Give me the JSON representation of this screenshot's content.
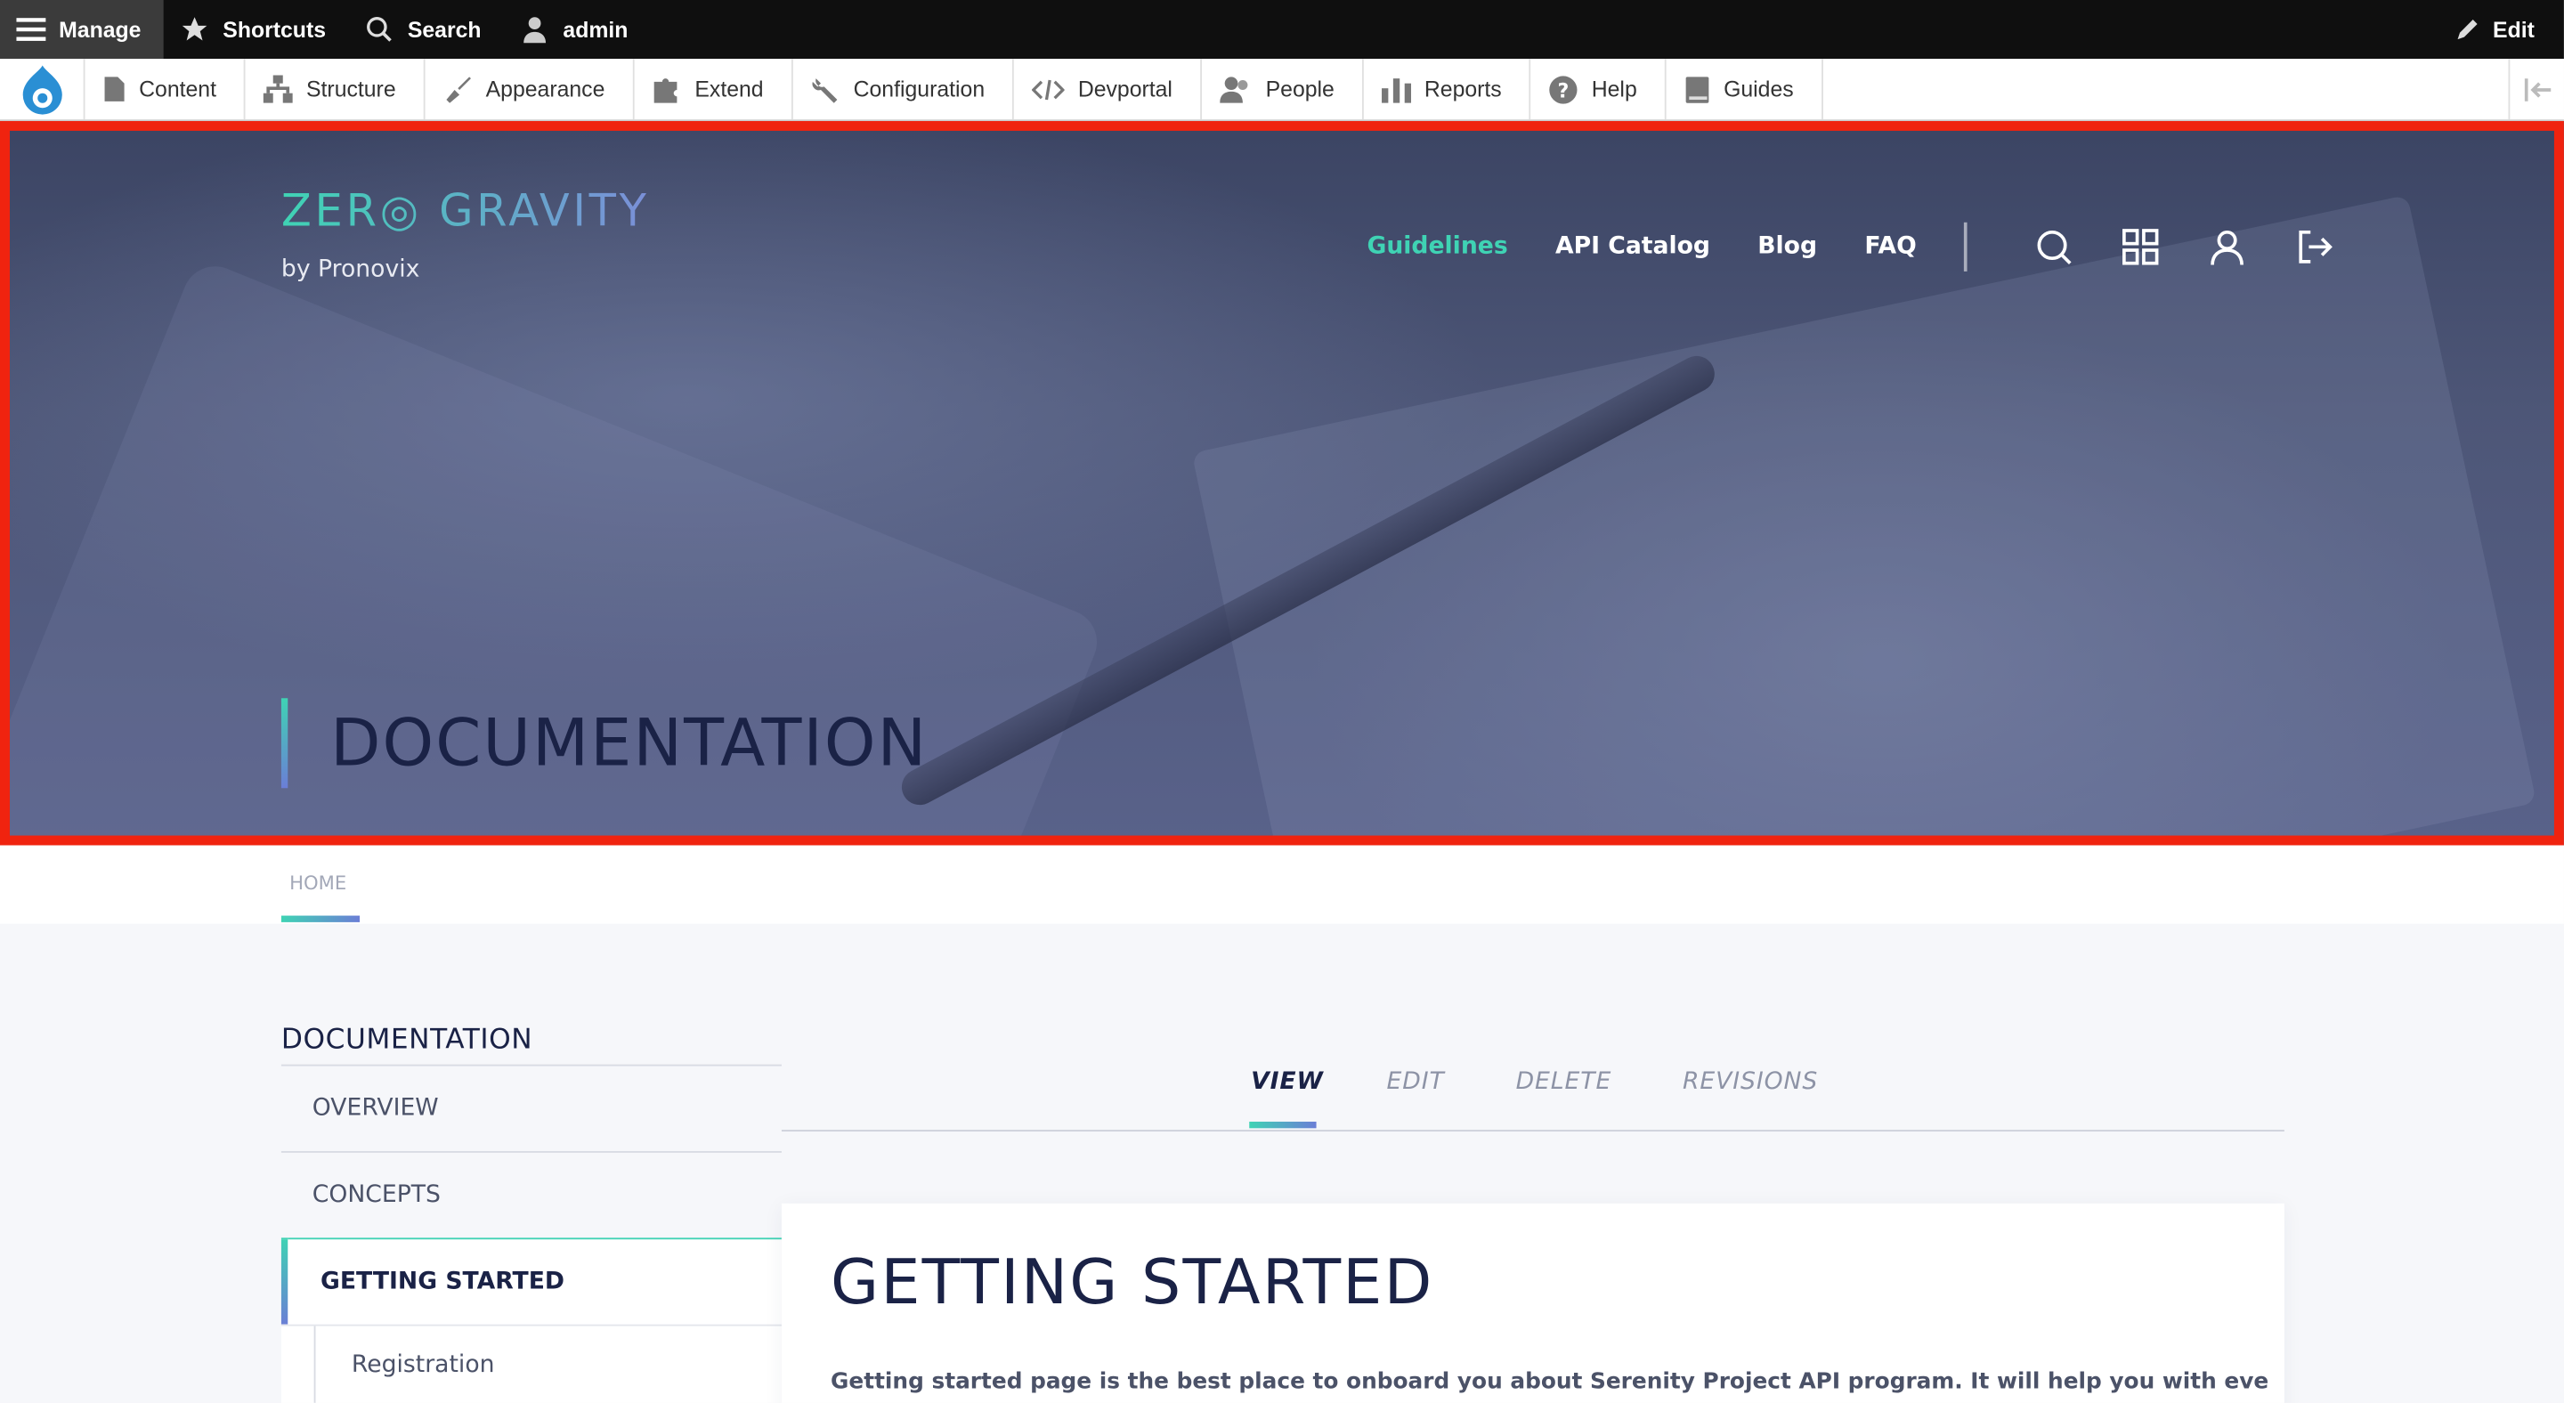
{
  "toolbar": {
    "manage": "Manage",
    "shortcuts": "Shortcuts",
    "search": "Search",
    "user": "admin",
    "edit": "Edit"
  },
  "tray": {
    "items": [
      {
        "label": "Content",
        "icon": "file-icon"
      },
      {
        "label": "Structure",
        "icon": "sitemap-icon"
      },
      {
        "label": "Appearance",
        "icon": "brush-icon"
      },
      {
        "label": "Extend",
        "icon": "puzzle-icon"
      },
      {
        "label": "Configuration",
        "icon": "wrench-icon"
      },
      {
        "label": "Devportal",
        "icon": "code-icon"
      },
      {
        "label": "People",
        "icon": "people-icon"
      },
      {
        "label": "Reports",
        "icon": "bar-chart-icon"
      },
      {
        "label": "Help",
        "icon": "help-icon"
      },
      {
        "label": "Guides",
        "icon": "book-icon"
      }
    ]
  },
  "hero": {
    "logo": "ZER◎ GRAVITY",
    "logo_sub": "by Pronovix",
    "nav": [
      "Guidelines",
      "API Catalog",
      "Blog",
      "FAQ"
    ],
    "active_nav": "Guidelines",
    "title": "DOCUMENTATION"
  },
  "breadcrumb": {
    "home": "HOME"
  },
  "sidebar": {
    "title": "DOCUMENTATION",
    "items": [
      "OVERVIEW",
      "CONCEPTS",
      "GETTING STARTED"
    ],
    "active": "GETTING STARTED",
    "sub": [
      "Registration"
    ]
  },
  "tabs": {
    "items": [
      "VIEW",
      "EDIT",
      "DELETE",
      "REVISIONS"
    ],
    "active": "VIEW"
  },
  "content": {
    "title": "GETTING STARTED",
    "text": "Getting started page is the best place to onboard you about Serenity Project API program. It will help you with every step"
  },
  "colors": {
    "accent_teal": "#3fd3b4",
    "accent_blue": "#6b7ed6",
    "navy": "#1a2246",
    "highlight_frame": "#f0230f"
  }
}
